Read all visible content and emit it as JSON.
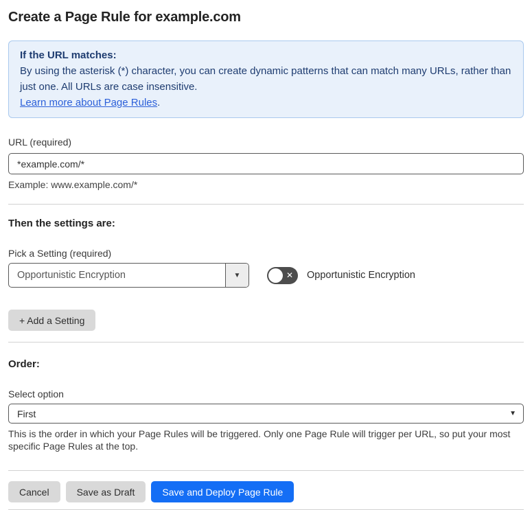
{
  "page": {
    "title": "Create a Page Rule for example.com"
  },
  "info_box": {
    "heading": "If the URL matches:",
    "body": "By using the asterisk (*) character, you can create dynamic patterns that can match many URLs, rather than just one. All URLs are case insensitive.",
    "link_text": "Learn more about Page Rules",
    "link_suffix": "."
  },
  "url_field": {
    "label": "URL (required)",
    "value": "*example.com/*",
    "helper": "Example: www.example.com/*"
  },
  "settings_section": {
    "heading": "Then the settings are:",
    "picker_label": "Pick a Setting (required)",
    "picker_value": "Opportunistic Encryption",
    "toggle": {
      "state": "off",
      "label": "Opportunistic Encryption"
    },
    "add_button_label": "+ Add a Setting"
  },
  "order_section": {
    "heading": "Order:",
    "label": "Select option",
    "selected_value": "First",
    "helper": "This is the order in which your Page Rules will be triggered. Only one Page Rule will trigger per URL, so put your most specific Page Rules at the top."
  },
  "footer": {
    "cancel_label": "Cancel",
    "save_draft_label": "Save as Draft",
    "save_deploy_label": "Save and Deploy Page Rule"
  },
  "icons": {
    "dropdown_arrow": "▼",
    "select_arrow": "▼",
    "toggle_off_x": "✕"
  },
  "colors": {
    "accent_blue": "#146ef5",
    "info_background": "#e9f1fb",
    "info_border": "#a9c9ee",
    "info_text": "#1e3c70",
    "link_blue": "#2b5fd9",
    "toggle_background": "#4d4d4d",
    "gray_button": "#d9d9d9"
  }
}
